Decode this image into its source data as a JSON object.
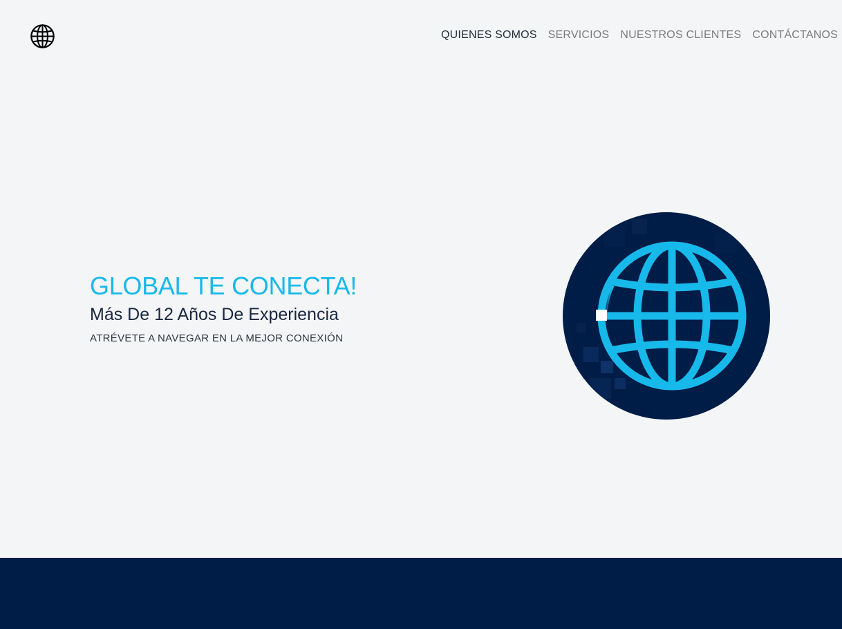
{
  "header": {
    "logo_icon": "globe-icon",
    "nav": [
      {
        "label": "QUIENES SOMOS",
        "active": true
      },
      {
        "label": "SERVICIOS",
        "active": false
      },
      {
        "label": "NUESTROS CLIENTES",
        "active": false
      },
      {
        "label": "CONTÁCTANOS",
        "active": false
      }
    ]
  },
  "hero": {
    "title": "GLOBAL TE CONECTA!",
    "subtitle": "Más De 12 Años De Experiencia",
    "tagline": "ATRÉVETE A NAVEGAR EN LA MEJOR CONEXIÓN",
    "illustration_icon": "globe-icon"
  },
  "colors": {
    "background": "#f4f5f7",
    "accent": "#17b9ea",
    "navy": "#001d48",
    "text_dark": "#1a2740",
    "nav_inactive": "#7b7b7b"
  }
}
